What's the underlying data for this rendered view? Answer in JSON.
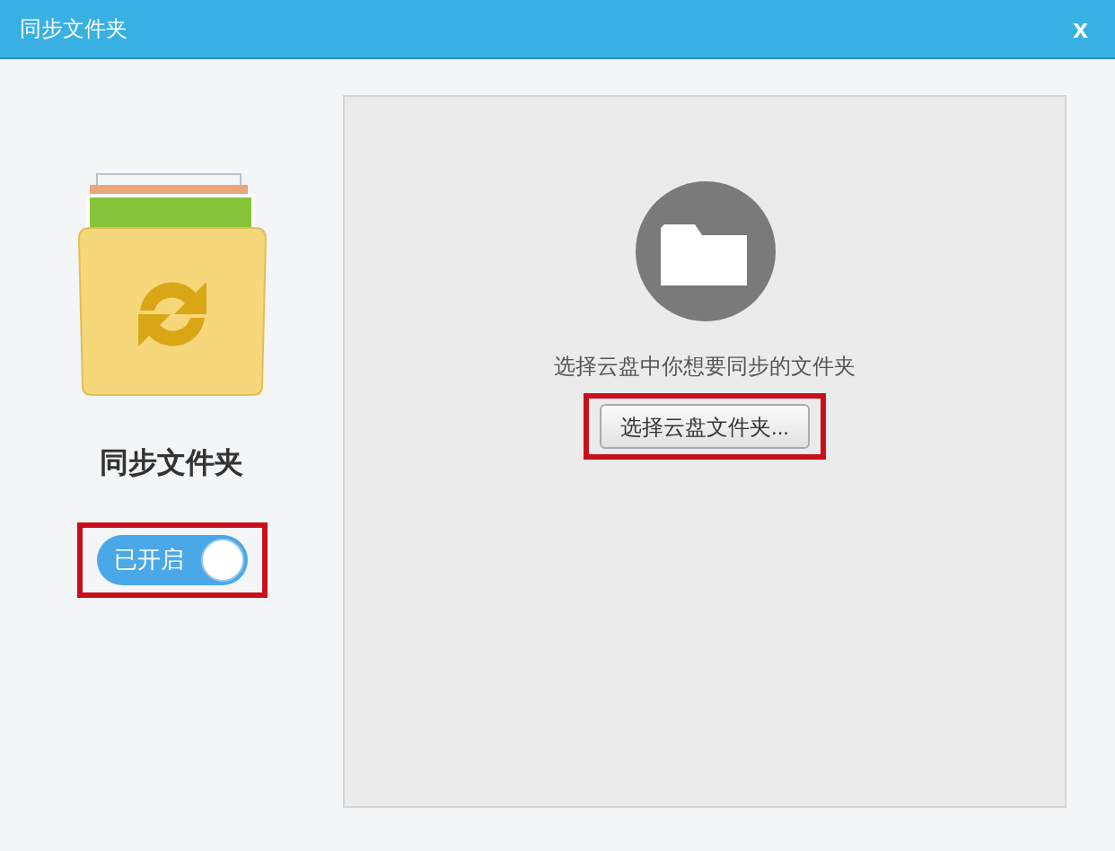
{
  "window": {
    "title": "同步文件夹",
    "close": "x"
  },
  "sync": {
    "title": "同步文件夹",
    "toggle": {
      "label": "已开启",
      "on": true
    }
  },
  "panel": {
    "prompt": "选择云盘中你想要同步的文件夹",
    "button": "选择云盘文件夹..."
  }
}
